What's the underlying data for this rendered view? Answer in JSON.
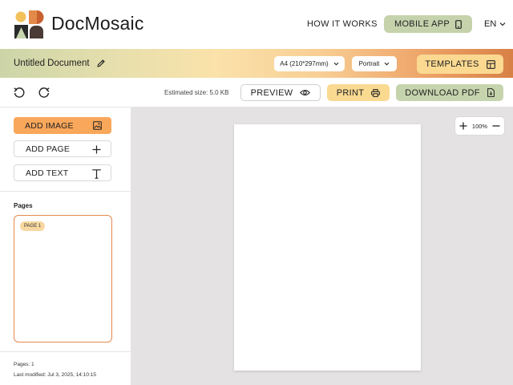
{
  "header": {
    "brand": "DocMosaic",
    "nav_how_it_works": "HOW IT WORKS",
    "mobile_app_label": "MOBILE APP",
    "language": "EN",
    "icons": [
      "logo-mosaic",
      "phone-icon",
      "chevron-down-icon"
    ]
  },
  "document_bar": {
    "title": "Untitled Document",
    "page_size": "A4 (210*297mm)",
    "orientation": "Portrait",
    "templates_label": "TEMPLATES"
  },
  "toolbar": {
    "estimated_size": "Estimated size: 5.0 KB",
    "preview_label": "PREVIEW",
    "print_label": "PRINT",
    "download_label": "DOWNLOAD PDF"
  },
  "sidebar": {
    "add_image_label": "ADD IMAGE",
    "add_page_label": "ADD PAGE",
    "add_text_label": "ADD TEXT",
    "pages_heading": "Pages",
    "pages": [
      {
        "badge": "PAGE 1"
      }
    ],
    "footer_pages": "Pages: 1",
    "footer_modified": "Last modified: Jul 3, 2025, 14:10:15"
  },
  "canvas": {
    "zoom_level": "100%"
  },
  "colors": {
    "accent_orange": "#f9a75a",
    "accent_green": "#c6d4ad",
    "accent_yellow": "#fad991",
    "page_border": "#e48a4f",
    "canvas_bg": "#e4e2e3"
  }
}
